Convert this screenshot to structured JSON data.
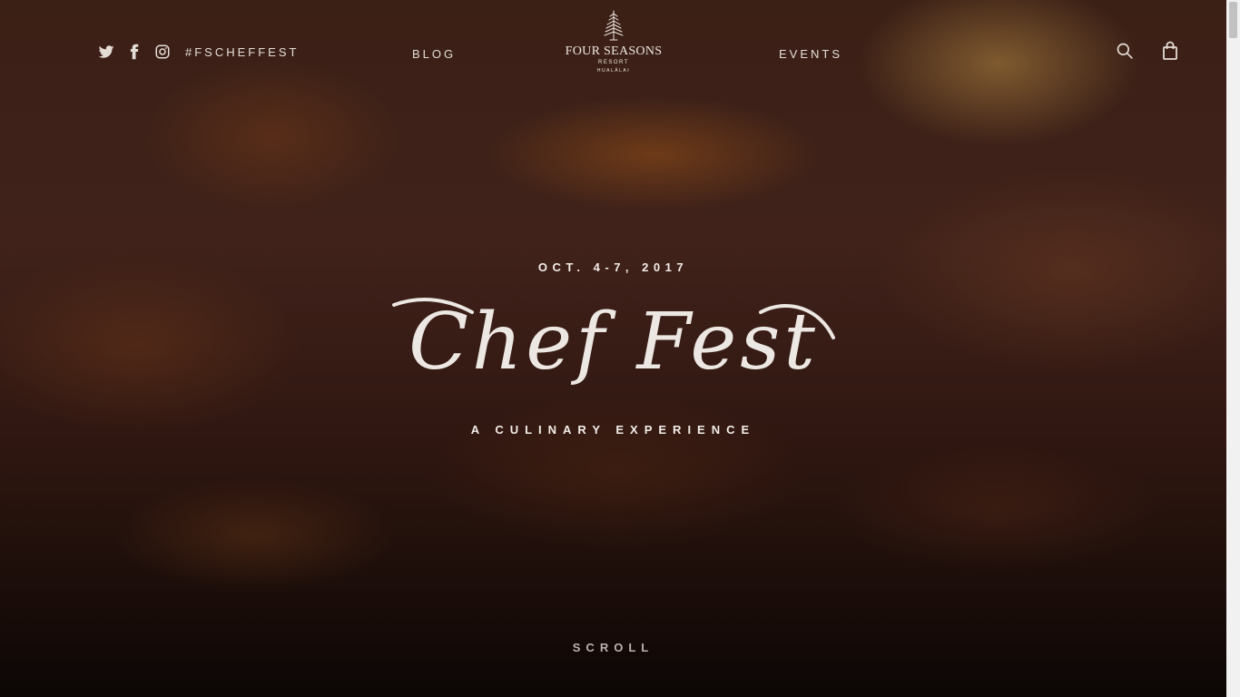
{
  "header": {
    "social": [
      {
        "icon": "twitter-icon"
      },
      {
        "icon": "facebook-icon"
      },
      {
        "icon": "instagram-icon"
      }
    ],
    "hashtag": "#FSCHEFFEST",
    "nav_left": "BLOG",
    "nav_right": "EVENTS",
    "logo": {
      "name": "FOUR SEASONS",
      "line1": "RESORT",
      "line2": "HUALĀLAI"
    },
    "search_icon": "search-icon",
    "cart_icon": "shopping-bag-icon"
  },
  "hero": {
    "date": "OCT. 4-7, 2017",
    "title": "Chef Fest",
    "subtitle": "A CULINARY EXPERIENCE",
    "scroll": "SCROLL"
  },
  "colors": {
    "text": "#f3eee9",
    "muted": "#b9b2ad",
    "background": "#3b2016"
  }
}
